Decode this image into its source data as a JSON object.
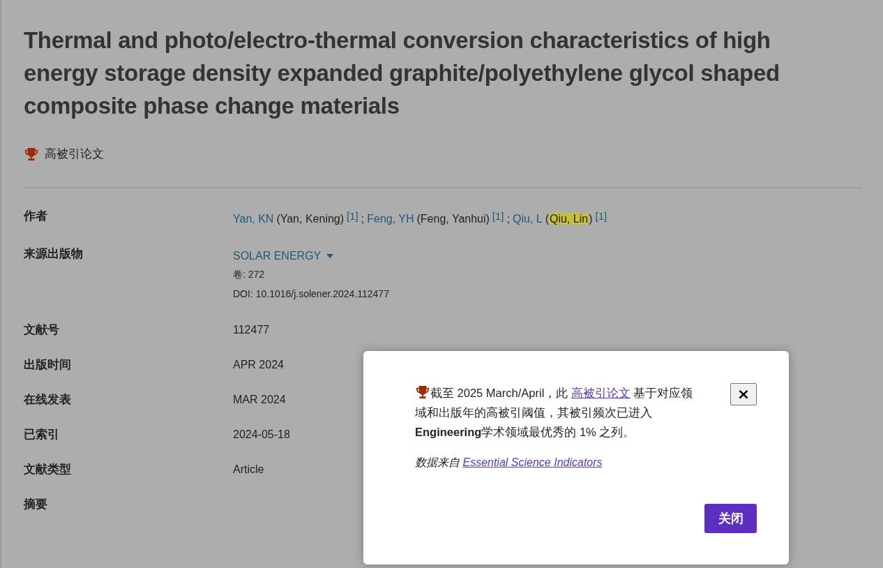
{
  "title": "Thermal and photo/electro-thermal conversion characteristics of high energy storage density expanded graphite/polyethylene glycol shaped composite phase change materials",
  "badge": {
    "label": "高被引论文"
  },
  "fields": [
    {
      "kind": "authors",
      "label": "作者",
      "authors": [
        {
          "short": "Yan, KN",
          "open": "(",
          "full": "Yan, Kening",
          "close": ")",
          "highlighted": false,
          "affiliation": "[1]"
        },
        {
          "separator": ";",
          "short": "Feng, YH",
          "open": "(",
          "full": "Feng, Yanhui",
          "close": ")",
          "highlighted": false,
          "affiliation": "[1]"
        },
        {
          "separator": ";",
          "short": "Qiu, L",
          "open": "(",
          "full": "Qiu, Lin",
          "close": ")",
          "highlighted": true,
          "affiliation": "[1]"
        }
      ]
    },
    {
      "kind": "source",
      "label": "来源出版物",
      "journal": "SOLAR ENERGY",
      "lines": [
        "卷: 272",
        "DOI: 10.1016/j.solener.2024.112477"
      ]
    },
    {
      "kind": "text",
      "label": "文献号",
      "value": "112477"
    },
    {
      "kind": "text",
      "label": "出版时间",
      "value": "APR 2024"
    },
    {
      "kind": "text",
      "label": "在线发表",
      "value": "MAR 2024"
    },
    {
      "kind": "text",
      "label": "已索引",
      "value": "2024-05-18"
    },
    {
      "kind": "text",
      "label": "文献类型",
      "value": "Article"
    },
    {
      "kind": "text",
      "label": "摘要"
    }
  ],
  "dialog": {
    "before": "截至 2025 March/April，此 ",
    "link": "高被引论文",
    "after": " 基于对应领域和出版年的高被引阈值，其被引频次已进入 **Engineering**学术领域最优秀的 1% 之列。",
    "source_label": "数据来自",
    "source_link": "Essential Science Indicators",
    "close_icon": "×",
    "button": "关闭"
  }
}
